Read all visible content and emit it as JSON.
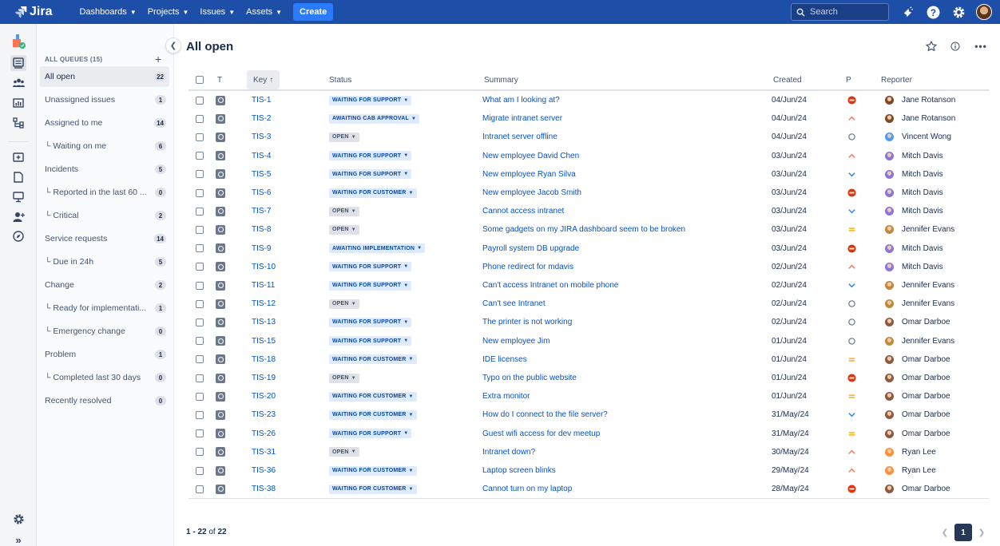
{
  "nav": {
    "logo": "Jira",
    "items": [
      {
        "label": "Dashboards"
      },
      {
        "label": "Projects"
      },
      {
        "label": "Issues"
      },
      {
        "label": "Assets"
      }
    ],
    "create_label": "Create",
    "search_placeholder": "Search"
  },
  "sidebar": {
    "header": "ALL QUEUES (15)",
    "items": [
      {
        "label": "All open",
        "count": "22",
        "active": true
      },
      {
        "label": "Unassigned issues",
        "count": "1"
      },
      {
        "label": "Assigned to me",
        "count": "14"
      },
      {
        "label": "└ Waiting on me",
        "count": "6"
      },
      {
        "label": "Incidents",
        "count": "5"
      },
      {
        "label": "└ Reported in the last 60 ...",
        "count": "0"
      },
      {
        "label": "└ Critical",
        "count": "2"
      },
      {
        "label": "Service requests",
        "count": "14"
      },
      {
        "label": "└ Due in 24h",
        "count": "5"
      },
      {
        "label": "Change",
        "count": "2"
      },
      {
        "label": "└ Ready for implementati...",
        "count": "1"
      },
      {
        "label": "└ Emergency change",
        "count": "0"
      },
      {
        "label": "Problem",
        "count": "1"
      },
      {
        "label": "└ Completed last 30 days",
        "count": "0"
      },
      {
        "label": "Recently resolved",
        "count": "0"
      }
    ]
  },
  "main": {
    "title": "All open",
    "columns": {
      "t": "T",
      "key": "Key",
      "status": "Status",
      "summary": "Summary",
      "created": "Created",
      "p": "P",
      "reporter": "Reporter"
    },
    "rows": [
      {
        "key": "TIS-1",
        "status": "WAITING FOR SUPPORT",
        "summary": "What am I looking at?",
        "created": "04/Jun/24",
        "priority": "highest",
        "reporter": "Jane Rotanson"
      },
      {
        "key": "TIS-2",
        "status": "AWAITING CAB APPROVAL",
        "summary": "Migrate intranet server",
        "created": "04/Jun/24",
        "priority": "high",
        "reporter": "Jane Rotanson"
      },
      {
        "key": "TIS-3",
        "status": "OPEN",
        "summary": "Intranet server offline",
        "created": "04/Jun/24",
        "priority": "none",
        "reporter": "Vincent Wong"
      },
      {
        "key": "TIS-4",
        "status": "WAITING FOR SUPPORT",
        "summary": "New employee David Chen",
        "created": "03/Jun/24",
        "priority": "high",
        "reporter": "Mitch Davis"
      },
      {
        "key": "TIS-5",
        "status": "WAITING FOR SUPPORT",
        "summary": "New employee Ryan Silva",
        "created": "03/Jun/24",
        "priority": "low",
        "reporter": "Mitch Davis"
      },
      {
        "key": "TIS-6",
        "status": "WAITING FOR CUSTOMER",
        "summary": "New employee Jacob Smith",
        "created": "03/Jun/24",
        "priority": "highest",
        "reporter": "Mitch Davis"
      },
      {
        "key": "TIS-7",
        "status": "OPEN",
        "summary": "Cannot access intranet",
        "created": "03/Jun/24",
        "priority": "low",
        "reporter": "Mitch Davis"
      },
      {
        "key": "TIS-8",
        "status": "OPEN",
        "summary": "Some gadgets on my JIRA dashboard seem to be broken",
        "created": "03/Jun/24",
        "priority": "medium",
        "reporter": "Jennifer Evans"
      },
      {
        "key": "TIS-9",
        "status": "AWAITING IMPLEMENTATION",
        "summary": "Payroll system DB upgrade",
        "created": "03/Jun/24",
        "priority": "highest",
        "reporter": "Mitch Davis"
      },
      {
        "key": "TIS-10",
        "status": "WAITING FOR SUPPORT",
        "summary": "Phone redirect for mdavis",
        "created": "02/Jun/24",
        "priority": "high",
        "reporter": "Mitch Davis"
      },
      {
        "key": "TIS-11",
        "status": "WAITING FOR SUPPORT",
        "summary": "Can't access Intranet on mobile phone",
        "created": "02/Jun/24",
        "priority": "low",
        "reporter": "Jennifer Evans"
      },
      {
        "key": "TIS-12",
        "status": "OPEN",
        "summary": "Can't see Intranet",
        "created": "02/Jun/24",
        "priority": "none",
        "reporter": "Jennifer Evans"
      },
      {
        "key": "TIS-13",
        "status": "WAITING FOR SUPPORT",
        "summary": "The printer is not working",
        "created": "02/Jun/24",
        "priority": "none",
        "reporter": "Omar Darboe"
      },
      {
        "key": "TIS-15",
        "status": "WAITING FOR SUPPORT",
        "summary": "New employee Jim",
        "created": "01/Jun/24",
        "priority": "none",
        "reporter": "Jennifer Evans"
      },
      {
        "key": "TIS-18",
        "status": "WAITING FOR CUSTOMER",
        "summary": "IDE licenses",
        "created": "01/Jun/24",
        "priority": "medium",
        "reporter": "Omar Darboe"
      },
      {
        "key": "TIS-19",
        "status": "OPEN",
        "summary": "Typo on the public website",
        "created": "01/Jun/24",
        "priority": "highest",
        "reporter": "Omar Darboe"
      },
      {
        "key": "TIS-20",
        "status": "WAITING FOR CUSTOMER",
        "summary": "Extra monitor",
        "created": "01/Jun/24",
        "priority": "medium",
        "reporter": "Omar Darboe"
      },
      {
        "key": "TIS-23",
        "status": "WAITING FOR CUSTOMER",
        "summary": "How do I connect to the file server?",
        "created": "31/May/24",
        "priority": "low",
        "reporter": "Omar Darboe"
      },
      {
        "key": "TIS-26",
        "status": "WAITING FOR SUPPORT",
        "summary": "Guest wifi access for dev meetup",
        "created": "31/May/24",
        "priority": "medium",
        "reporter": "Omar Darboe"
      },
      {
        "key": "TIS-31",
        "status": "OPEN",
        "summary": "Intranet down?",
        "created": "30/May/24",
        "priority": "high",
        "reporter": "Ryan Lee"
      },
      {
        "key": "TIS-36",
        "status": "WAITING FOR CUSTOMER",
        "summary": "Laptop screen blinks",
        "created": "29/May/24",
        "priority": "high",
        "reporter": "Ryan Lee"
      },
      {
        "key": "TIS-38",
        "status": "WAITING FOR CUSTOMER",
        "summary": "Cannot turn on my laptop",
        "created": "28/May/24",
        "priority": "highest",
        "reporter": "Omar Darboe"
      }
    ],
    "pagination": {
      "range": "1 - 22",
      "of": "of",
      "total": "22",
      "current_page": "1"
    }
  },
  "colors": {
    "topbar": "#1d4ea8",
    "link": "#0052cc",
    "priority_highest": "#de350b",
    "priority_high": "#ff7452",
    "priority_medium": "#ffab00",
    "priority_low": "#2684ff",
    "priority_none": "#6b778c"
  },
  "reporter_colors": {
    "Jane Rotanson": "#7a4a2a",
    "Vincent Wong": "#4c9aff",
    "Mitch Davis": "#8777d9",
    "Jennifer Evans": "#c08a3e",
    "Omar Darboe": "#8a5a44",
    "Ryan Lee": "#ff8f3a"
  }
}
